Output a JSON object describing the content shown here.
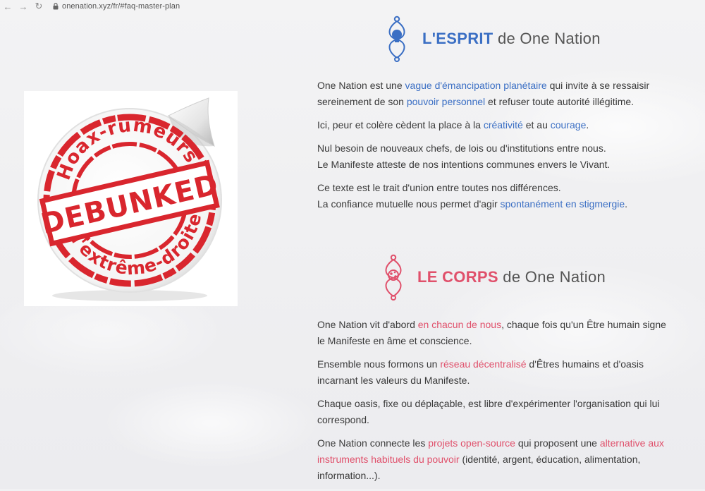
{
  "browser": {
    "url": "onenation.xyz/fr/#faq-master-plan"
  },
  "sticker": {
    "top_text": "Hoax-rumeurs",
    "center_text": "DEBUNKED",
    "bottom_text": "d'extrême-droite",
    "color": "#d9262e"
  },
  "esprit": {
    "title_strong": "L'ESPRIT",
    "title_rest": "de One Nation",
    "accent": "#3b6fc4",
    "p1": {
      "a": "One Nation est une ",
      "b": "vague d'émancipation planétaire",
      "c": " qui invite à se ressaisir sereinement de son ",
      "d": "pouvoir personnel",
      "e": " et refuser toute autorité illégitime."
    },
    "p2": {
      "a": "Ici, peur et colère cèdent la place à la ",
      "b": "créativité",
      "c": " et au ",
      "d": "courage",
      "e": "."
    },
    "p3": {
      "line1": "Nul besoin de nouveaux chefs, de lois ou d'institutions entre nous.",
      "line2": "Le Manifeste atteste de nos intentions communes envers le Vivant."
    },
    "p4": {
      "line1": "Ce texte est le trait d'union entre toutes nos différences.",
      "a": "La confiance mutuelle nous permet d'agir ",
      "b": "spontanément en stigmergie",
      "c": "."
    }
  },
  "corps": {
    "title_strong": "LE CORPS",
    "title_rest": "de One Nation",
    "accent": "#e0506b",
    "p1": {
      "a": "One Nation vit d'abord ",
      "b": "en chacun de nous",
      "c": ", chaque fois qu'un Être humain signe le Manifeste en âme et conscience."
    },
    "p2": {
      "a": "Ensemble nous formons un ",
      "b": "réseau décentralisé",
      "c": " d'Êtres humains et d'oasis incarnant les valeurs du Manifeste."
    },
    "p3": {
      "a": "Chaque oasis, fixe ou déplaçable, est libre d'expérimenter l'organisation qui lui correspond."
    },
    "p4": {
      "a": "One Nation connecte les ",
      "b": "projets open-source",
      "c": " qui proposent une ",
      "d": "alternative aux instruments habituels du pouvoir",
      "e": " (identité, argent, éducation, alimentation, information...)."
    }
  }
}
